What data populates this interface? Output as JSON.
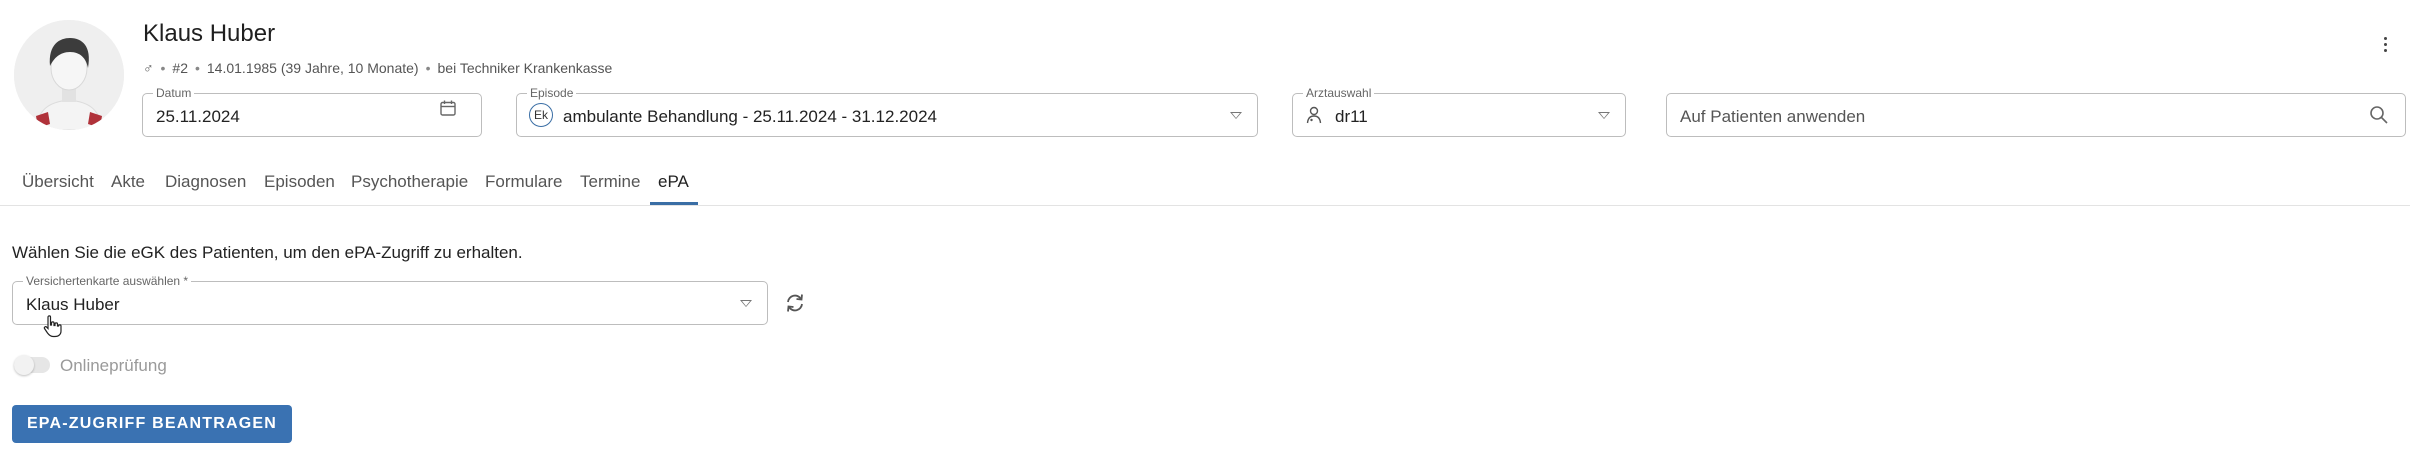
{
  "patient": {
    "name": "Klaus Huber",
    "gender_symbol": "♂",
    "number": "#2",
    "birthdate_age": "14.01.1985 (39 Jahre, 10 Monate)",
    "insurance": "bei Techniker Krankenkasse"
  },
  "fields": {
    "datum": {
      "label": "Datum",
      "value": "25.11.2024"
    },
    "episode": {
      "label": "Episode",
      "badge": "Ek",
      "value": "ambulante Behandlung - 25.11.2024 - 31.12.2024"
    },
    "arzt": {
      "label": "Arztauswahl",
      "value": "dr11"
    },
    "search": {
      "placeholder": "Auf Patienten anwenden"
    }
  },
  "tabs": [
    {
      "label": "Übersicht",
      "active": false
    },
    {
      "label": "Akte",
      "active": false
    },
    {
      "label": "Diagnosen",
      "active": false
    },
    {
      "label": "Episoden",
      "active": false
    },
    {
      "label": "Psychotherapie",
      "active": false
    },
    {
      "label": "Formulare",
      "active": false
    },
    {
      "label": "Termine",
      "active": false
    },
    {
      "label": "ePA",
      "active": true
    }
  ],
  "epa": {
    "info_text": "Wählen Sie die eGK des Patienten, um den ePA-Zugriff zu erhalten.",
    "card_select": {
      "label": "Versichertenkarte auswählen *",
      "value": "Klaus Huber"
    },
    "online_check": {
      "label": "Onlineprüfung",
      "enabled": false
    },
    "request_button": "EPA-ZUGRIFF BEANTRAGEN"
  },
  "colors": {
    "accent": "#3a72b2",
    "tab_underline": "#3a6ea5",
    "border": "#bdbdbd"
  },
  "icons": [
    "avatar",
    "more-vert-icon",
    "calendar-icon",
    "chevron-down-icon",
    "doctor-icon",
    "search-icon",
    "refresh-icon",
    "mouse-cursor-icon"
  ]
}
